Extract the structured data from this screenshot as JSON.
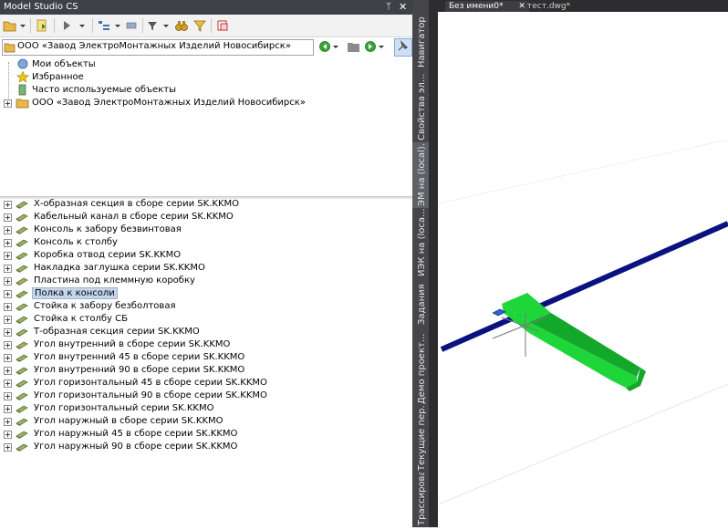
{
  "window": {
    "title": "Model Studio CS",
    "pin_glyph": "ᛘ",
    "close_glyph": "✕"
  },
  "toolbar": {
    "buttons": [
      {
        "icon": "open-folder-icon"
      },
      {
        "icon": "import-icon"
      },
      {
        "icon": "play-icon"
      },
      {
        "icon": "tree-view-icon"
      },
      {
        "icon": "list-icon"
      },
      {
        "icon": "filter-icon"
      },
      {
        "icon": "binoculars-icon"
      },
      {
        "icon": "funnel-icon"
      },
      {
        "icon": "layers-icon"
      }
    ]
  },
  "path": {
    "value": "ООО «Завод ЭлектроМонтажных Изделий Новосибирск»",
    "icons": [
      "back-arrow-icon",
      "folder-icon",
      "forward-arrow-icon",
      "pin-icon"
    ]
  },
  "top_tree": [
    {
      "label": "Мои объекты",
      "icon": "my-objects-icon"
    },
    {
      "label": "Избранное",
      "icon": "star-icon"
    },
    {
      "label": "Часто используемые объекты",
      "icon": "frequent-icon"
    },
    {
      "label": "ООО «Завод ЭлектроМонтажных Изделий Новосибирск»",
      "icon": "folder-icon"
    }
  ],
  "items": [
    "Х-образная секция в сборе серии SK.KKMO",
    "Кабельный канал в сборе серии SK.KKMO",
    "Консоль к забору безвинтовая",
    "Консоль к столбу",
    "Коробка отвод серии SK.KKMO",
    "Накладка заглушка серии SK.KKMO",
    "Пластина под клеммную коробку",
    "Полка к консоли",
    "Стойка к забору безболтовая",
    "Стойка к столбу СБ",
    "Т-образная секция серии SK.KKMO",
    "Угол внутренний в сборе серии SK.KKMO",
    "Угол внутренний 45 в сборе серии SK.KKMO",
    "Угол внутренний 90 в сборе серии SK.KKMO",
    "Угол горизонтальный 45 в сборе серии SK.KKMO",
    "Угол горизонтальный 90 в сборе серии SK.KKMO",
    "Угол горизонтальный серии SK.KKMO",
    "Угол наружный в сборе серии SK.KKMO",
    "Угол наружный 45 в сборе серии SK.KKMO",
    "Угол наружный 90 в сборе серии SK.KKMO"
  ],
  "selected_item": "Полка к консоли",
  "side_tabs": [
    {
      "label": "Навигатор",
      "active": false
    },
    {
      "label": "Свойства эл...",
      "active": false
    },
    {
      "label": "ЭМ на (local)...",
      "active": true
    },
    {
      "label": "ИЭК на (loca...",
      "active": false
    },
    {
      "label": "Задания",
      "active": false
    },
    {
      "label": "Демо проект...",
      "active": false
    },
    {
      "label": "Текущие пер...",
      "active": false
    },
    {
      "label": "Трассирование",
      "active": false
    }
  ],
  "doc_tabs": [
    {
      "label": "Без имени0*",
      "close": "✕"
    },
    {
      "label": "тест.dwg*"
    }
  ],
  "colors": {
    "title_bar": "#3f3f46",
    "selection": "#c5d5ea",
    "pipe": "#0a1280",
    "shelf": "#1fd63a",
    "shelf_dark": "#14a82b"
  }
}
